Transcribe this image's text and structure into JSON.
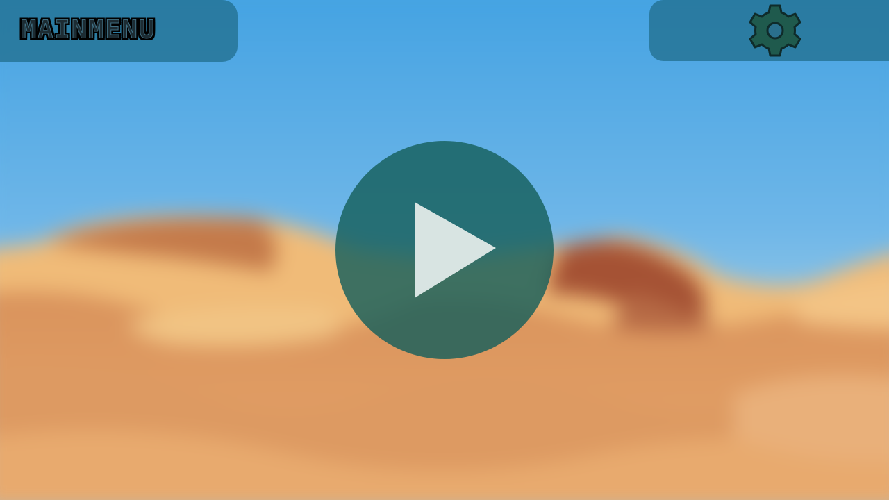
{
  "header": {
    "main_menu_label": "MAINMENU"
  },
  "icons": {
    "settings": "gear-icon",
    "play": "play-icon"
  },
  "colors": {
    "panel": "#2a6f8c",
    "play_circle": "#1d6a66",
    "play_triangle": "#d8e4e2",
    "gear_fill": "#1f5a4d",
    "gear_outline": "#0f2b2a",
    "sky": "#4aa5e3",
    "sand": "#e2a466"
  }
}
